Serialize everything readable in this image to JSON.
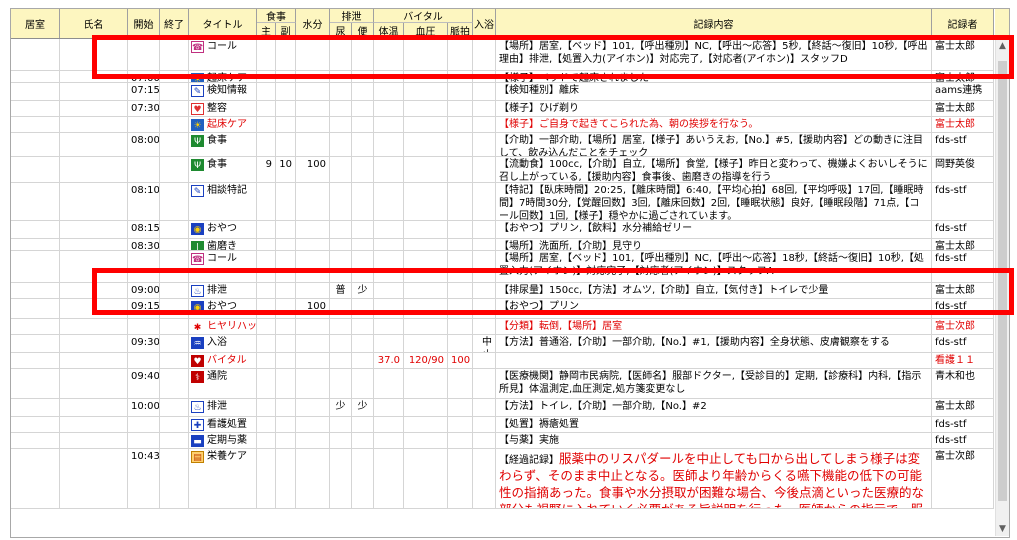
{
  "header": {
    "room": "居室",
    "name": "氏名",
    "start": "開始",
    "end": "終了",
    "title": "タイトル",
    "meal": "食事",
    "meal_main": "主",
    "meal_side": "副",
    "water": "水分",
    "excretion": "排泄",
    "urine": "尿",
    "stool": "便",
    "vital": "バイタル",
    "temp": "体温",
    "bp": "血圧",
    "pulse": "脈拍",
    "bath": "入浴",
    "content": "記録内容",
    "recorder": "記録者"
  },
  "rows": [
    {
      "start": "",
      "title": "コール",
      "icon": "call-icon",
      "content": "【場所】居室,【ベッド】101,【呼出種別】NC,【呼出～応答】5秒,【終話～復旧】10秒,【呼出理由】排泄,【処置入力(アイホン)】対応完了,【対応者(アイホン)】スタッフD",
      "recorder": "富士太郎"
    },
    {
      "start": "07:00",
      "title": "起床ケア",
      "icon": "sunrise-icon",
      "content": "【様子】ベッドで起床されました",
      "recorder": "富士太郎"
    },
    {
      "start": "07:15",
      "title": "検知情報",
      "icon": "sensor-icon",
      "content": "【検知種別】離床",
      "recorder": "aams連携"
    },
    {
      "start": "07:30",
      "title": "整容",
      "icon": "grooming-icon",
      "content": "【様子】ひげ剃り",
      "recorder": "富士太郎"
    },
    {
      "start": "",
      "title": "起床ケア",
      "icon": "sunrise-icon",
      "red": true,
      "content": "【様子】ご自身で起きてこられた為、朝の挨拶を行なう。",
      "recorder": "富士太郎"
    },
    {
      "start": "08:00",
      "title": "食事",
      "icon": "meal-icon",
      "content": "【介助】一部介助,【場所】居室,【様子】あいうえお,【No.】#5,【援助内容】どの動きに注目して、飲み込んだことをチェック",
      "recorder": "fds-stf"
    },
    {
      "start": "",
      "title": "食事",
      "icon": "meal-icon",
      "main": "9",
      "side": "10",
      "water": "100",
      "content": "【流動食】100cc,【介助】自立,【場所】食堂,【様子】昨日と変わって、機嫌よくおいしそうに召し上がっている,【援助内容】食事後、歯磨きの指導を行う",
      "recorder": "岡野英俊"
    },
    {
      "start": "08:10",
      "title": "相談特記",
      "icon": "consult-icon",
      "content": "【特記】【臥床時間】20:25,【離床時間】6:40,【平均心拍】68回,【平均呼吸】17回,【睡眠時間】7時間30分,【覚醒回数】3回,【離床回数】2回,【睡眠状態】良好,【睡眠段階】71点,【コール回数】1回,【様子】穏やかに過ごされています。",
      "recorder": "fds-stf"
    },
    {
      "start": "08:15",
      "title": "おやつ",
      "icon": "snack-icon",
      "content": "【おやつ】プリン,【飲料】水分補給ゼリー",
      "recorder": "fds-stf"
    },
    {
      "start": "08:30",
      "title": "歯磨き",
      "icon": "toothbrush-icon",
      "content": "【場所】洗面所,【介助】見守り",
      "recorder": "富士太郎"
    },
    {
      "start": "",
      "title": "コール",
      "icon": "call-icon",
      "content": "【場所】居室,【ベッド】101,【呼出種別】NC,【呼出～応答】18秒,【終話～復旧】10秒,【処置入力(アイホン)】対応完了,【対応者(アイホン)】スタッフA",
      "recorder": "fds-stf"
    },
    {
      "start": "09:00",
      "title": "排泄",
      "icon": "toilet-icon",
      "urine": "普",
      "stool": "少",
      "content": "【排尿量】150cc,【方法】オムツ,【介助】自立,【気付き】トイレで少量",
      "recorder": "富士太郎"
    },
    {
      "start": "09:15",
      "title": "おやつ",
      "icon": "snack-icon",
      "water": "100",
      "content": "【おやつ】プリン",
      "recorder": "fds-stf"
    },
    {
      "start": "",
      "title": "ヒヤリハット",
      "icon": "alert-icon",
      "red": true,
      "content": "【分類】転倒,【場所】居室",
      "recorder": "富士次郎"
    },
    {
      "start": "09:30",
      "title": "入浴",
      "icon": "bath-icon",
      "bath": "中止",
      "content": "【方法】普通浴,【介助】一部介助,【No.】#1,【援助内容】全身状態、皮膚観察をする",
      "recorder": "fds-stf"
    },
    {
      "start": "",
      "title": "バイタル",
      "icon": "vital-icon",
      "red": true,
      "temp": "37.0",
      "bp": "120/90",
      "pulse": "100",
      "content": "",
      "recorder": "看護１１"
    },
    {
      "start": "09:40",
      "title": "通院",
      "icon": "hospital-icon",
      "content": "【医療機関】静岡市民病院,【医師名】服部ドクター,【受診目的】定期,【診療科】内科,【指示所見】体温測定,血圧測定,処方箋変更なし",
      "recorder": "青木和也"
    },
    {
      "start": "10:00",
      "title": "排泄",
      "icon": "toilet-icon",
      "urine": "少",
      "stool": "少",
      "content": "【方法】トイレ,【介助】一部介助,【No.】#2",
      "recorder": "富士太郎"
    },
    {
      "start": "",
      "title": "看護処置",
      "icon": "nurse-icon",
      "content": "【処置】褥瘡処置",
      "recorder": "fds-stf"
    },
    {
      "start": "",
      "title": "定期与薬",
      "icon": "medicine-icon",
      "content": "【与薬】実施",
      "recorder": "fds-stf"
    },
    {
      "start": "10:43",
      "title": "栄養ケア",
      "icon": "nutrition-icon",
      "content_prefix": "【経過記録】",
      "content_big": "服薬中のリスパダールを中止しても口から出してしまう様子は変わらず、そのまま中止となる。医師より年齢からくる嚥下機能の低下の可能性の指摘あった。食事や水分摂取が困難な場合、今後点滴といった医療的な部分も視野に入れていく必要がある旨説明を行った。医師からの指示で、服薬方法の工夫について試行し結果を",
      "recorder": "富士次郎"
    }
  ],
  "colors": {
    "header_bg": "#fdf6c0",
    "highlight": "#ff0000",
    "red_text": "#e00000"
  }
}
